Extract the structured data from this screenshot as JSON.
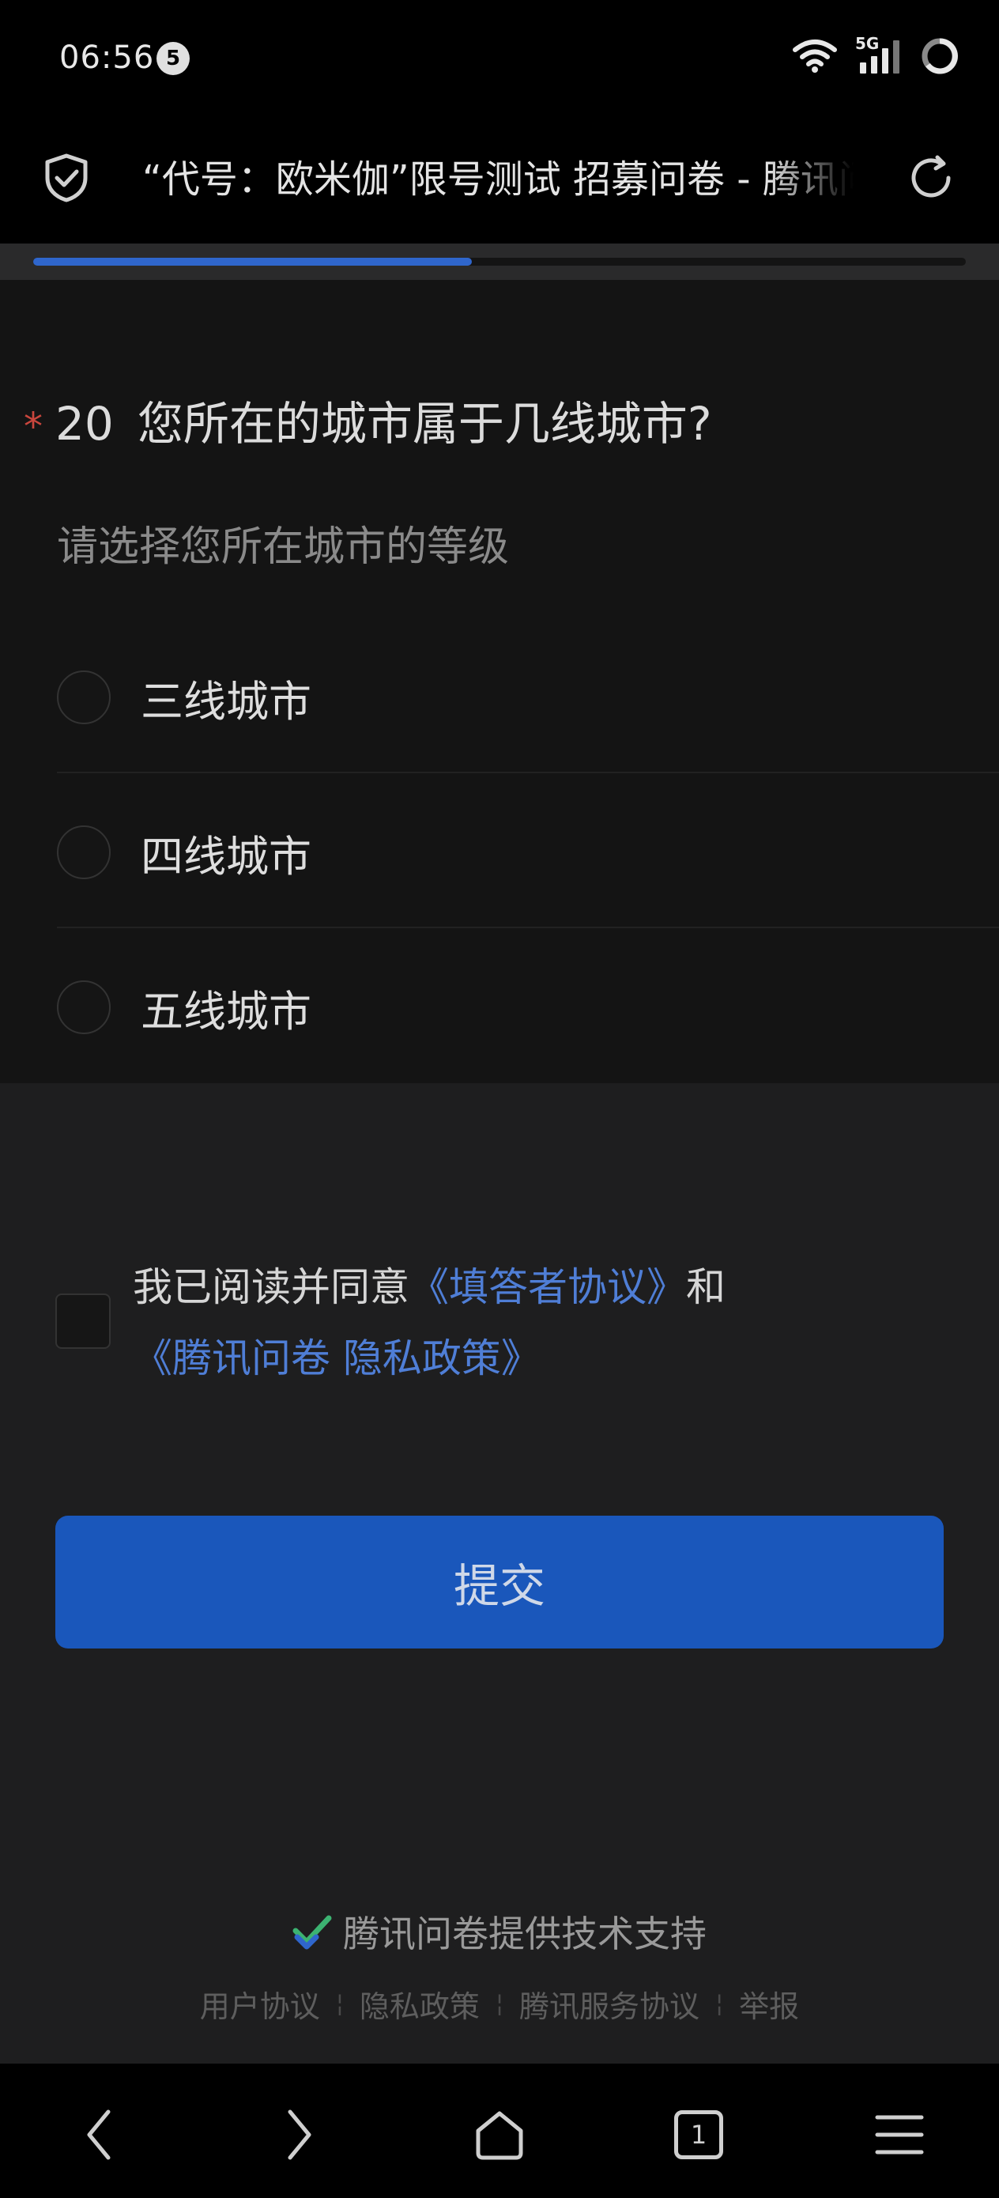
{
  "status_bar": {
    "time": "06:56",
    "notification_count": "5",
    "network": "5G",
    "icons": [
      "wifi-icon",
      "signal-icon",
      "battery-ring-icon"
    ]
  },
  "address_bar": {
    "page_title": "“代号：欧米伽”限号测试 招募问卷 - 腾讯问卷",
    "icons": [
      "shield-check-icon",
      "reload-icon"
    ]
  },
  "progress": {
    "fraction": 0.47,
    "accent_color": "#2f66cc"
  },
  "question": {
    "required_mark": "*",
    "number": "20",
    "title": "您所在的城市属于几线城市?",
    "description": "请选择您所在城市的等级",
    "options": [
      {
        "label": "三线城市"
      },
      {
        "label": "四线城市"
      },
      {
        "label": "五线城市"
      }
    ]
  },
  "agreement": {
    "prefix": "我已阅读并同意",
    "link_1": "《填答者协议》",
    "middle": "和",
    "link_2": "《腾讯问卷 隐私政策》",
    "link_color": "#4f7ed6"
  },
  "submit": {
    "label": "提交",
    "color": "#1a57bb"
  },
  "footer": {
    "support_text": "腾讯问卷提供技术支持",
    "links": [
      "用户协议",
      "隐私政策",
      "腾讯服务协议",
      "举报"
    ],
    "separator": "¦"
  },
  "nav_bar": {
    "tab_count": "1",
    "icons": [
      "back-icon",
      "forward-icon",
      "home-icon",
      "tabs-icon",
      "menu-icon"
    ]
  }
}
